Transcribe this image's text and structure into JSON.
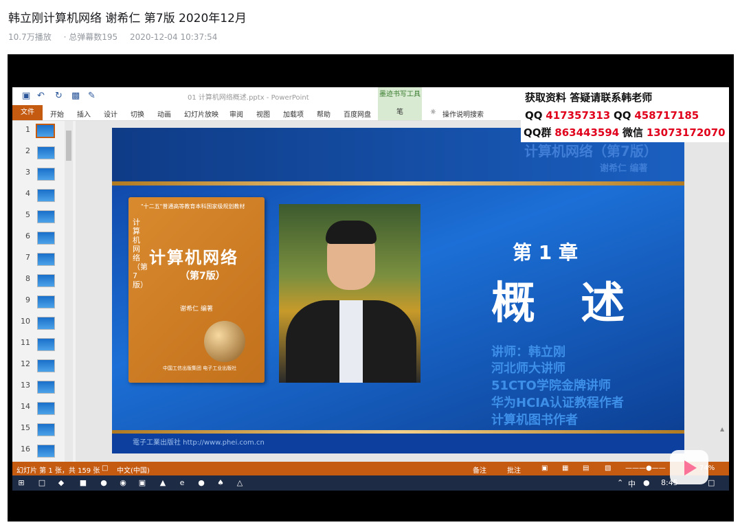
{
  "video": {
    "title": "韩立刚计算机网络 谢希仁 第7版 2020年12月",
    "views": "10.7万播放",
    "danmaku": "· 总弹幕数195",
    "datetime": "2020-12-04 10:37:54"
  },
  "ppt": {
    "doc_title": "01 计算机网络概述.pptx  -  PowerPoint",
    "tool_label": "墨迹书写工具",
    "tabs": [
      "文件",
      "开始",
      "插入",
      "设计",
      "切换",
      "动画",
      "幻灯片放映",
      "审阅",
      "视图",
      "加载项",
      "帮助",
      "百度网盘",
      "笔"
    ],
    "tell_me": "操作说明搜索",
    "thumbs": [
      "1",
      "2",
      "3",
      "4",
      "5",
      "6",
      "7",
      "8",
      "9",
      "10",
      "11",
      "12",
      "13",
      "14",
      "15",
      "16"
    ],
    "status_left": "幻灯片 第 1 张，共 159 张",
    "status_lang": "中文(中国)",
    "status_notes": "备注",
    "status_comments": "批注",
    "zoom": "74%"
  },
  "slide": {
    "ghost_title": "计算机网络（第7版）",
    "ghost_author": "谢希仁  编著",
    "book_series": "\"十二五\"普通高等教育本科国家级规划教材",
    "book_vertical": "计算机网络（第7版）",
    "book_title": "计算机网络",
    "book_edition": "（第7版）",
    "book_author": "谢希仁  编著",
    "book_publishers": "中国工信出版集团   电子工业出版社",
    "chapter": "第 1 章",
    "chapter_title": "概 述",
    "lecturer_lines": [
      "讲师：韩立刚",
      "河北师大讲师",
      "51CTO学院金牌讲师",
      "华为HCIA认证教程作者",
      "计算机图书作者"
    ],
    "publisher_logo": "電子工業出版社 http://www.phei.com.cn"
  },
  "contact": {
    "line1": "获取资料 答疑请联系韩老师",
    "qq1_label": "QQ",
    "qq1": "417357313",
    "qq2_label": "QQ",
    "qq2": "458717185",
    "group_label": "QQ群",
    "group": "863443594",
    "wechat_label": "微信",
    "wechat": "13073172070"
  },
  "taskbar": {
    "tray_text": "中",
    "clock": "8:45"
  },
  "colors": {
    "ppt_orange": "#c55a11",
    "slide_blue": "#1c6fd6",
    "contact_red": "#e0001b"
  }
}
